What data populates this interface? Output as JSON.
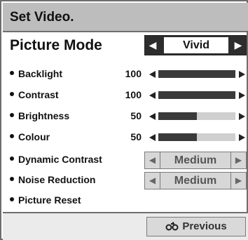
{
  "header": {
    "title": "Set Video."
  },
  "picture_mode": {
    "label": "Picture Mode",
    "value": "Vivid",
    "arrow_left": "◀",
    "arrow_right": "▶"
  },
  "sliders": [
    {
      "label": "Backlight",
      "value": "100",
      "level_percent": 100
    },
    {
      "label": "Contrast",
      "value": "100",
      "level_percent": 100
    },
    {
      "label": "Brightness",
      "value": "50",
      "level_percent": 50
    },
    {
      "label": "Colour",
      "value": "50",
      "level_percent": 50
    }
  ],
  "selectors": [
    {
      "label": "Dynamic Contrast",
      "value": "Medium",
      "arrow_left": "◀",
      "arrow_right": "▶"
    },
    {
      "label": "Noise Reduction",
      "value": "Medium",
      "arrow_left": "◀",
      "arrow_right": "▶"
    }
  ],
  "picture_reset": {
    "label": "Picture Reset"
  },
  "footer": {
    "previous_label": "Previous",
    "previous_icon": "return-arrow-icon"
  },
  "colors": {
    "header_bg": "#bdbdbd",
    "selector_active": "#2d2d2d",
    "selector_inactive": "#d7d7d7",
    "slider_fill": "#3a3a3a",
    "slider_track": "#cfcfcf"
  }
}
